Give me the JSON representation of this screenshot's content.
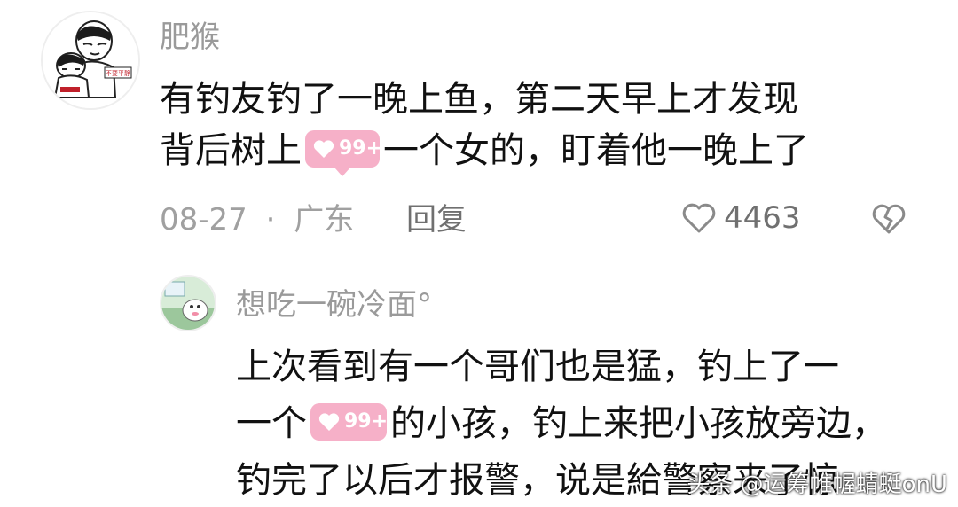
{
  "comment": {
    "username": "肥猴",
    "text_line1": "有钓友钓了一晚上鱼，第二天早上才发现",
    "text_line2_before": "背后树上",
    "text_line2_after": "一个女的，盯着他一晚上了",
    "date": "08-27",
    "separator": "·",
    "location": "广东",
    "reply_label": "回复",
    "like_count": "4463",
    "avatar_badge_text": "不要平静"
  },
  "reply": {
    "username": "想吃一碗冷面°",
    "text_line1": "上次看到有一个哥们也是猛，钓上了一",
    "text_line2_before": "一个",
    "text_line2_after": "的小孩，钓上来把小孩放旁边，",
    "text_line3": "钓完了以后才报警，说是給警察来了惊"
  },
  "badge": {
    "count": "99+",
    "color": "#f6b0c8"
  },
  "watermark": {
    "text": "头条 @运筹帷幄蜻蜓onU"
  },
  "icons": {
    "like": "heart-outline-icon",
    "dislike": "broken-heart-icon",
    "badge": "heart-icon"
  }
}
